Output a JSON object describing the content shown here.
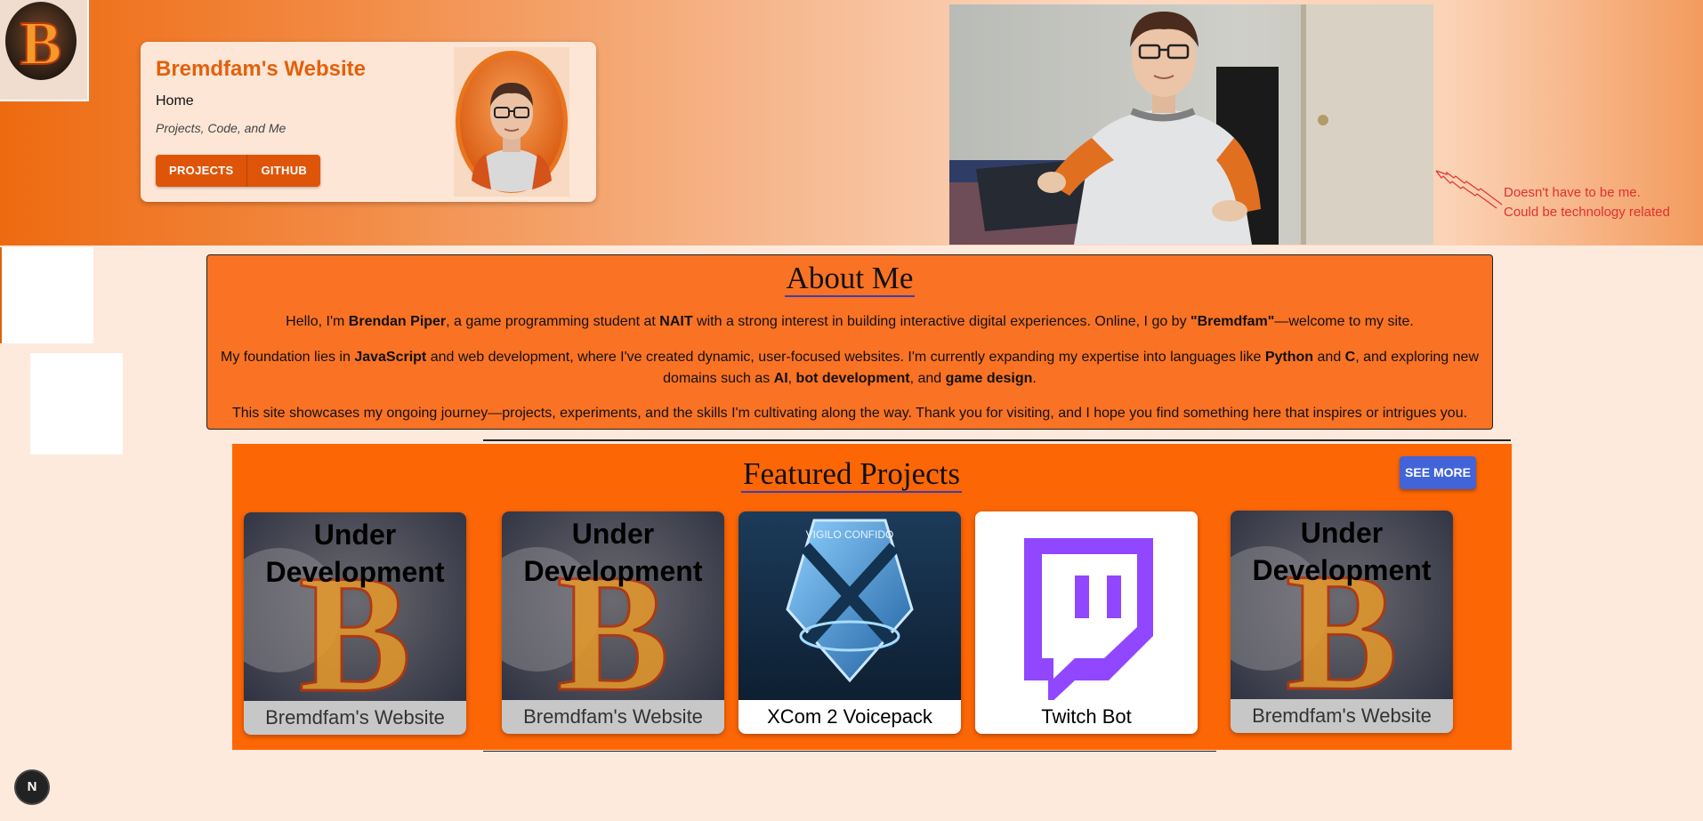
{
  "header": {
    "site_title": "Bremdfam's Website",
    "nav_home": "Home",
    "tagline": "Projects, Code, and Me",
    "buttons": [
      "PROJECTS",
      "GITHUB"
    ],
    "annotation": "Doesn't have to be me. Could be technology related"
  },
  "about": {
    "heading": "About Me",
    "p1": {
      "t1": "Hello, I'm ",
      "b1": "Brendan Piper",
      "t2": ", a game programming student at ",
      "b2": "NAIT",
      "t3": " with a strong interest in building interactive digital experiences. Online, I go by ",
      "b3": "\"Bremdfam\"",
      "t4": "—welcome to my site."
    },
    "p2": {
      "t1": "My foundation lies in ",
      "b1": "JavaScript",
      "t2": " and web development, where I've created dynamic, user-focused websites. I'm currently expanding my expertise into languages like ",
      "b2": "Python",
      "t3": " and ",
      "b3": "C",
      "t4": ", and exploring new domains such as ",
      "b4": "AI",
      "t5": ", ",
      "b5": "bot development",
      "t6": ", and ",
      "b6": "game design",
      "t7": "."
    },
    "p3": "This site showcases my ongoing journey—projects, experiments, and the skills I'm cultivating along the way. Thank you for visiting, and I hope you find something here that inspires or intrigues you."
  },
  "projects": {
    "heading": "Featured Projects",
    "see_more": "SEE MORE",
    "items": [
      {
        "overlay": "Under Development",
        "caption": "Bremdfam's Website"
      },
      {
        "overlay": "Under Development",
        "caption": "Bremdfam's Website"
      },
      {
        "overlay": "",
        "caption": "XCom 2 Voicepack",
        "badge": "VIGILO CONFIDO"
      },
      {
        "overlay": "",
        "caption": "Twitch Bot"
      },
      {
        "overlay": "Under Development",
        "caption": "Bremdfam's Website"
      }
    ]
  },
  "dev_badge": "N",
  "colors": {
    "accent": "#fd6605",
    "title": "#e2610b",
    "see_more": "#4363d8"
  }
}
